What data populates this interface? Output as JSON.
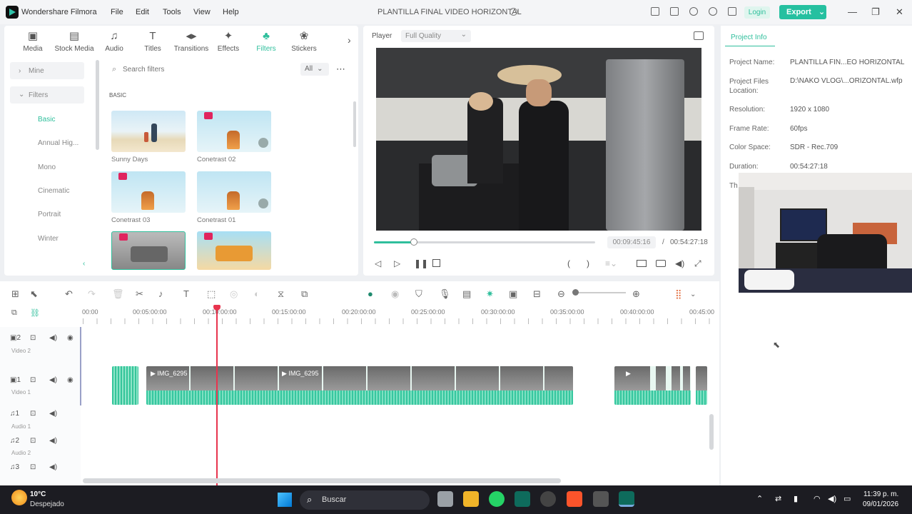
{
  "app": {
    "name": "Wondershare Filmora",
    "project_title": "PLANTILLA FINAL VIDEO HORIZONTAL",
    "login": "Login",
    "export": "Export"
  },
  "menu": [
    "File",
    "Edit",
    "Tools",
    "View",
    "Help"
  ],
  "tabs": [
    {
      "label": "Media",
      "icon": "media-icon"
    },
    {
      "label": "Stock Media",
      "icon": "stock-media-icon"
    },
    {
      "label": "Audio",
      "icon": "music-note-icon"
    },
    {
      "label": "Titles",
      "icon": "text-icon"
    },
    {
      "label": "Transitions",
      "icon": "transitions-icon"
    },
    {
      "label": "Effects",
      "icon": "effects-icon"
    },
    {
      "label": "Filters",
      "icon": "filters-icon"
    },
    {
      "label": "Stickers",
      "icon": "stickers-icon"
    }
  ],
  "sidebar": {
    "mine": "Mine",
    "filters": "Filters",
    "items": [
      "Basic",
      "Annual Hig...",
      "Mono",
      "Cinematic",
      "Portrait",
      "Winter"
    ]
  },
  "search": {
    "placeholder": "Search filters",
    "filter": "All"
  },
  "section": "BASIC",
  "thumbs": [
    "Sunny Days",
    "Conetrast 02",
    "Conetrast 03",
    "Conetrast 01"
  ],
  "player": {
    "label": "Player",
    "quality": "Full Quality",
    "current": "00:09:45:16",
    "total": "00:54:27:18",
    "progress": 0.18
  },
  "project_info": {
    "tab": "Project Info",
    "rows": [
      {
        "k": "Project Name:",
        "v": "PLANTILLA FIN...EO HORIZONTAL"
      },
      {
        "k": "Project Files Location:",
        "v": "D:\\NAKO VLOG\\...ORIZONTAL.wfp"
      },
      {
        "k": "Resolution:",
        "v": "1920 x 1080"
      },
      {
        "k": "Frame Rate:",
        "v": "60fps"
      },
      {
        "k": "Color Space:",
        "v": "SDR - Rec.709"
      },
      {
        "k": "Duration:",
        "v": "00:54:27:18"
      }
    ],
    "partial": "Th"
  },
  "ruler": [
    "00:00",
    "00:05:00:00",
    "00:10:00:00",
    "00:15:00:00",
    "00:20:00:00",
    "00:25:00:00",
    "00:30:00:00",
    "00:35:00:00",
    "00:40:00:00",
    "00:45:00"
  ],
  "tracks": {
    "v2": "Video 2",
    "v1": "Video 1",
    "a1": "Audio 1",
    "a2": "Audio 2",
    "v2num": "2",
    "v1num": "1",
    "a1num": "1",
    "a2num": "2",
    "a3num": "3"
  },
  "clips": [
    "IMG_6295",
    "IMG_6295"
  ],
  "taskbar": {
    "temp": "10°C",
    "weather": "Despejado",
    "search": "Buscar",
    "time": "11:39 p. m.",
    "date": "09/01/2026"
  }
}
